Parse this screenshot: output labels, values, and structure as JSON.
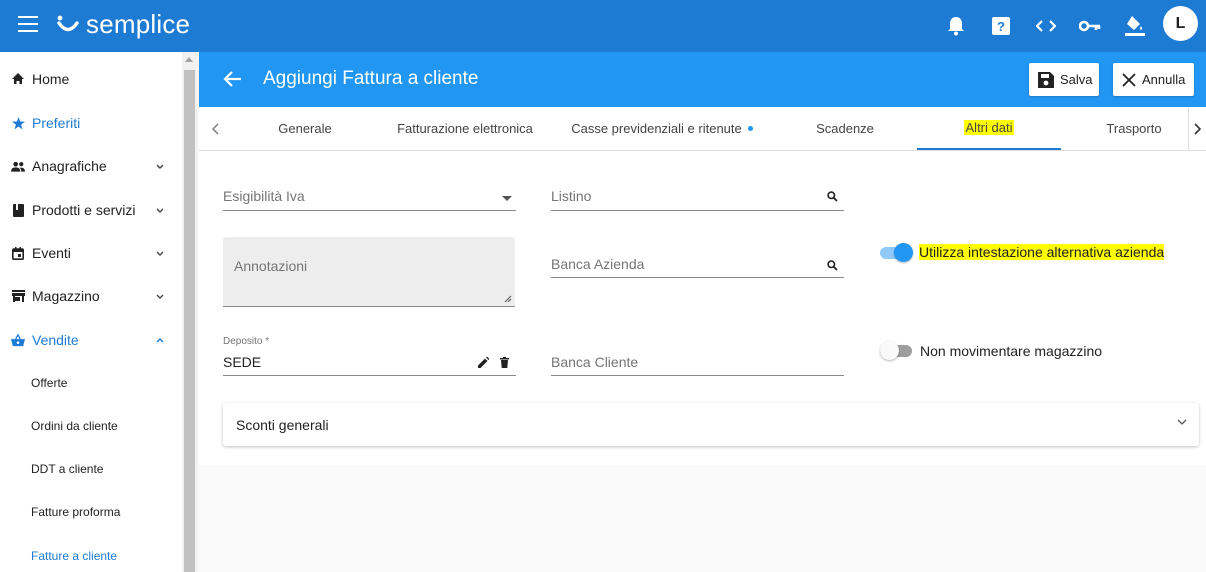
{
  "app": {
    "logo_text": "semplice",
    "avatar_initial": "L"
  },
  "topbar_icons": [
    "bell-icon",
    "help-icon",
    "code-icon",
    "key-icon",
    "paint-bucket-icon"
  ],
  "sidebar": {
    "items": [
      {
        "label": "Home",
        "icon": "home-icon"
      },
      {
        "label": "Preferiti",
        "icon": "star-icon"
      },
      {
        "label": "Anagrafiche",
        "icon": "people-icon"
      },
      {
        "label": "Prodotti e servizi",
        "icon": "book-icon"
      },
      {
        "label": "Eventi",
        "icon": "calendar-icon"
      },
      {
        "label": "Magazzino",
        "icon": "store-icon"
      },
      {
        "label": "Vendite",
        "icon": "basket-icon"
      }
    ],
    "sub_items": [
      "Offerte",
      "Ordini da cliente",
      "DDT a cliente",
      "Fatture proforma",
      "Fatture a cliente"
    ]
  },
  "header": {
    "title": "Aggiungi Fattura a cliente",
    "save_label": "Salva",
    "cancel_label": "Annulla"
  },
  "tabs": [
    "Generale",
    "Fatturazione elettronica",
    "Casse previdenziali e ritenute",
    "Scadenze",
    "Altri dati",
    "Trasporto"
  ],
  "form": {
    "esigibilita_label": "Esigibilità Iva",
    "listino_label": "Listino",
    "annotazioni_label": "Annotazioni",
    "banca_azienda_label": "Banca Azienda",
    "deposito_label": "Deposito *",
    "deposito_value": "SEDE",
    "banca_cliente_label": "Banca Cliente",
    "toggle_intestazione_label": "Utilizza intestazione alternativa azienda",
    "toggle_intestazione_on": true,
    "toggle_magazzino_label": "Non movimentare magazzino",
    "toggle_magazzino_on": false,
    "sconti_label": "Sconti generali"
  },
  "colors": {
    "primary": "#1e7bd4",
    "header": "#2196f3",
    "highlight": "#ffff00"
  }
}
